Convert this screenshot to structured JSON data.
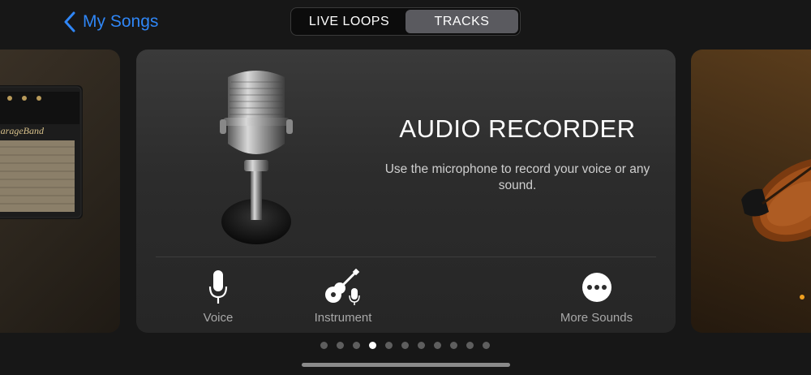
{
  "header": {
    "back_label": "My Songs",
    "tabs": [
      {
        "label": "LIVE LOOPS",
        "active": false
      },
      {
        "label": "TRACKS",
        "active": true
      }
    ]
  },
  "card": {
    "title": "AUDIO RECORDER",
    "description": "Use the microphone to record your voice or any sound.",
    "options": [
      {
        "label": "Voice",
        "icon": "microphone-icon"
      },
      {
        "label": "Instrument",
        "icon": "guitar-microphone-icon"
      },
      {
        "label": "More Sounds",
        "icon": "more-ellipsis-icon"
      }
    ]
  },
  "side_cards": {
    "left_art": "guitar-amp",
    "right_art": "violin"
  },
  "pagination": {
    "count": 11,
    "active_index": 3
  },
  "colors": {
    "accent": "#2f86f6",
    "background": "#171717",
    "card": "#2e2e2e",
    "indicator": "#f0a020"
  }
}
